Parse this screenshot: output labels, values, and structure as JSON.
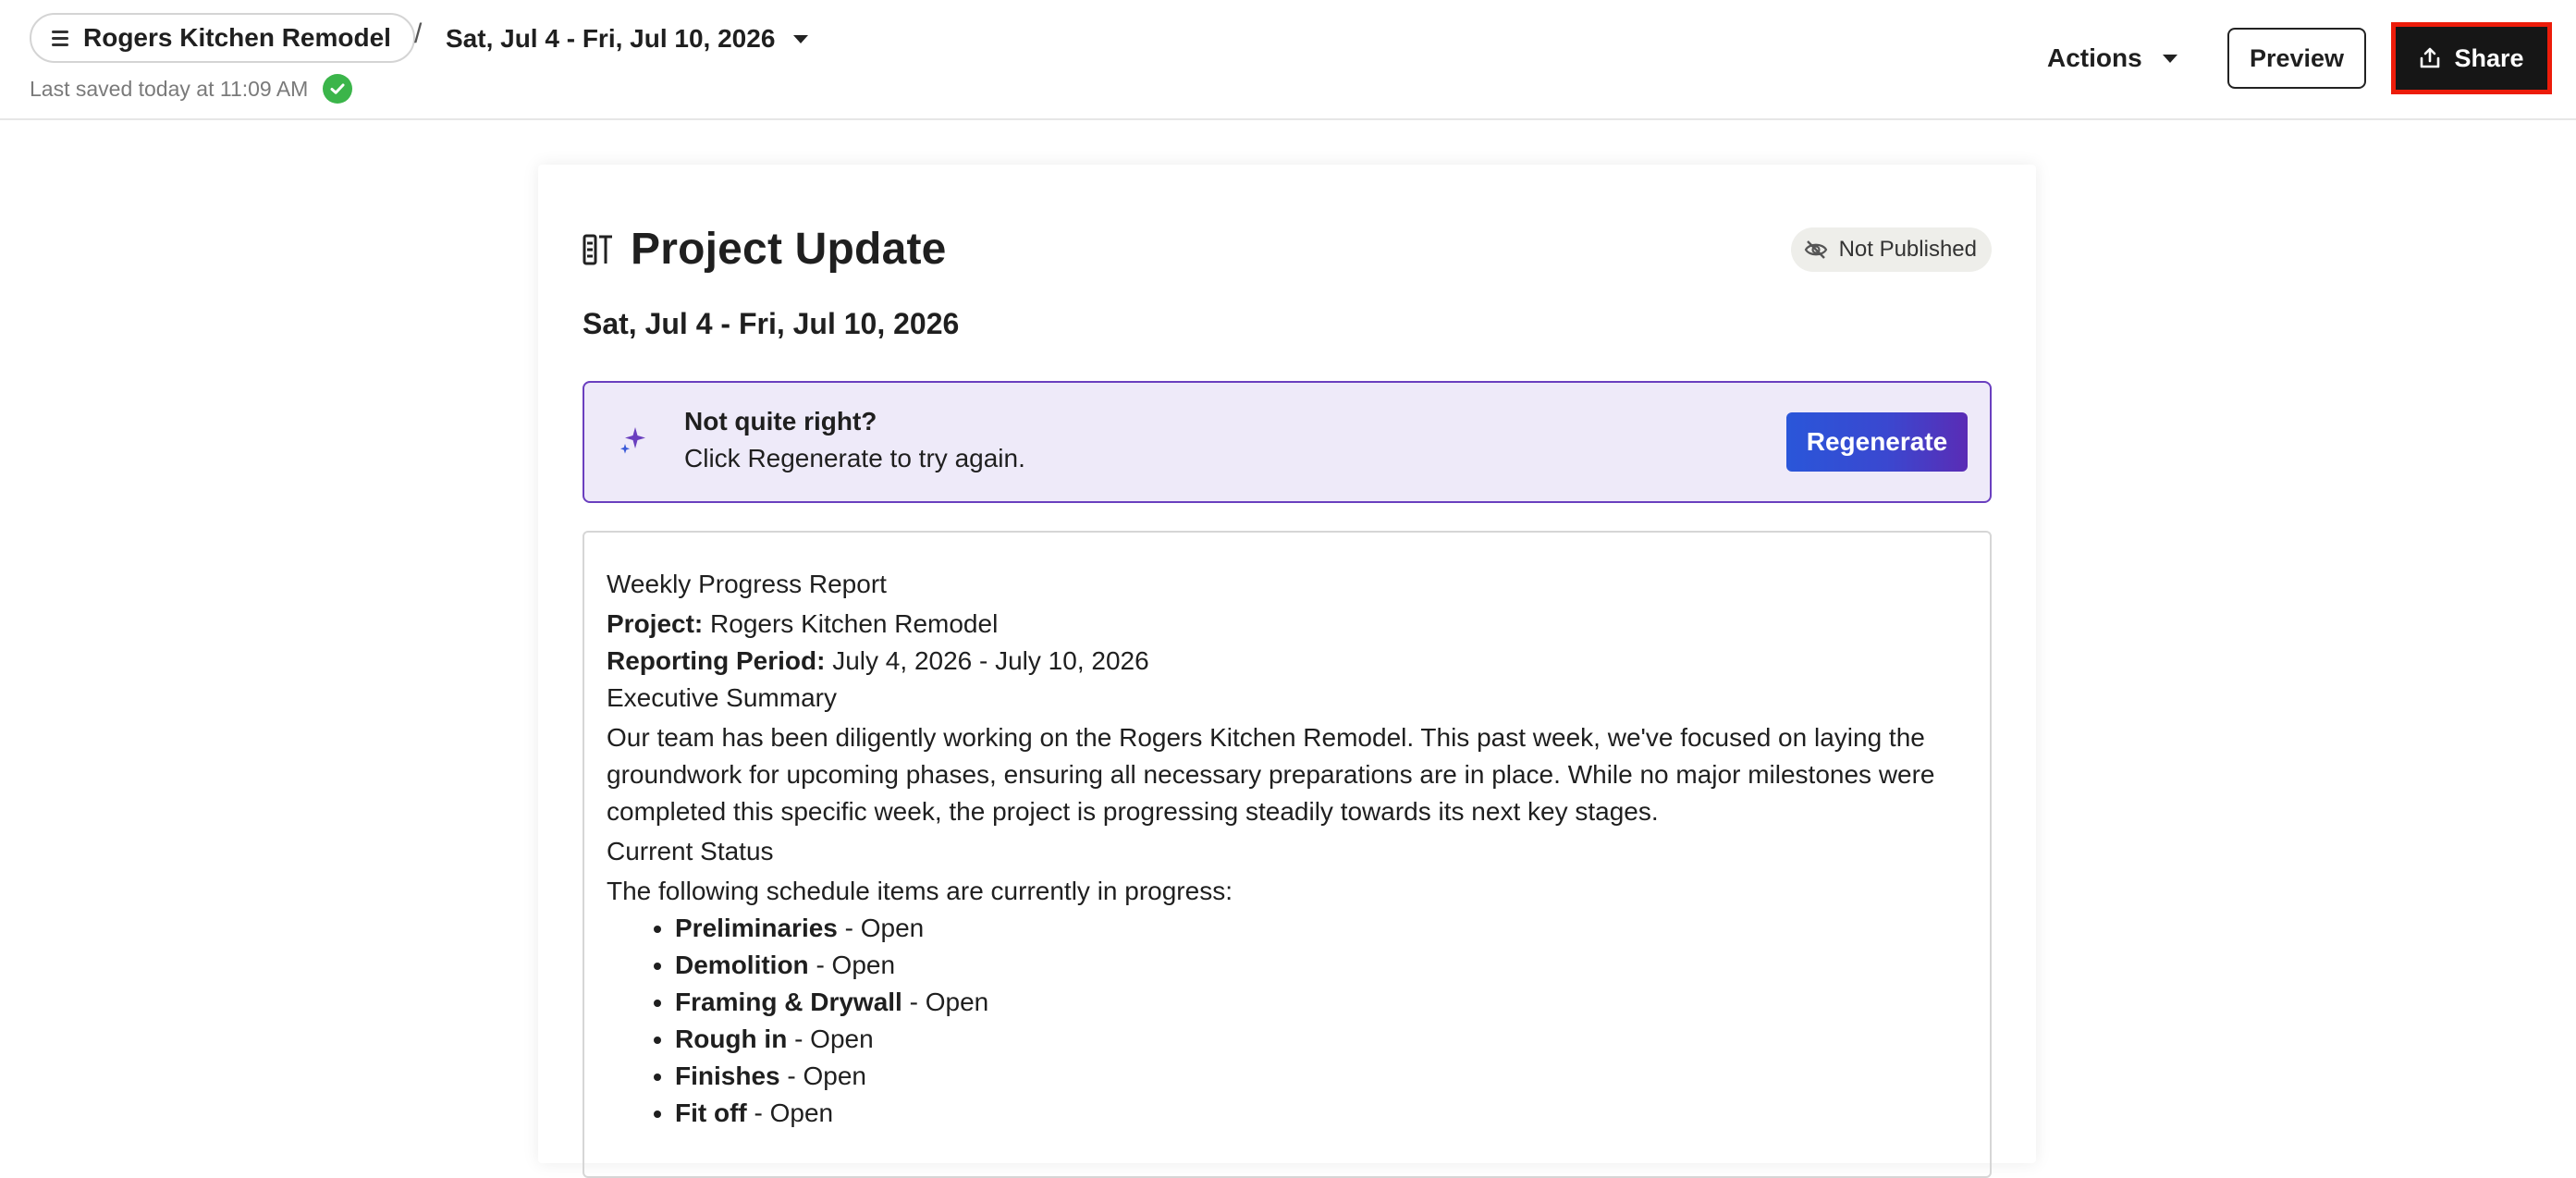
{
  "header": {
    "project_name": "Rogers Kitchen Remodel",
    "separator": "/",
    "date_range": "Sat, Jul 4 - Fri, Jul 10, 2026",
    "last_saved": "Last saved today at 11:09 AM",
    "actions_label": "Actions",
    "preview_label": "Preview",
    "share_label": "Share"
  },
  "card": {
    "title": "Project Update",
    "status_badge": "Not Published",
    "date_range": "Sat, Jul 4 - Fri, Jul 10, 2026",
    "banner": {
      "title": "Not quite right?",
      "subtitle": "Click Regenerate to try again.",
      "button_label": "Regenerate"
    },
    "report": {
      "heading": "Weekly Progress Report",
      "project_label": "Project:",
      "project_value": "Rogers Kitchen Remodel",
      "period_label": "Reporting Period:",
      "period_value": "July 4, 2026 - July 10, 2026",
      "summary_heading": "Executive Summary",
      "summary_text": "Our team has been diligently working on the Rogers Kitchen Remodel. This past week, we've focused on laying the groundwork for upcoming phases, ensuring all necessary preparations are in place. While no major milestones were completed this specific week, the project is progressing steadily towards its next key stages.",
      "status_heading": "Current Status",
      "status_intro": "The following schedule items are currently in progress:",
      "items": [
        {
          "name": "Preliminaries",
          "status": "- Open"
        },
        {
          "name": "Demolition",
          "status": "- Open"
        },
        {
          "name": "Framing & Drywall",
          "status": "- Open"
        },
        {
          "name": "Rough in",
          "status": "- Open"
        },
        {
          "name": "Finishes",
          "status": "- Open"
        },
        {
          "name": "Fit off",
          "status": "- Open"
        }
      ]
    }
  },
  "colors": {
    "accent_purple": "#6a3fbf",
    "regenerate_blue": "#2a56d9",
    "success_green": "#3bb54a",
    "highlight_red": "#ec1c0a"
  },
  "icons": [
    "menu-icon",
    "chevron-down-icon",
    "check-circle-icon",
    "share-icon",
    "report-icon",
    "eye-off-icon",
    "sparkle-icon"
  ]
}
